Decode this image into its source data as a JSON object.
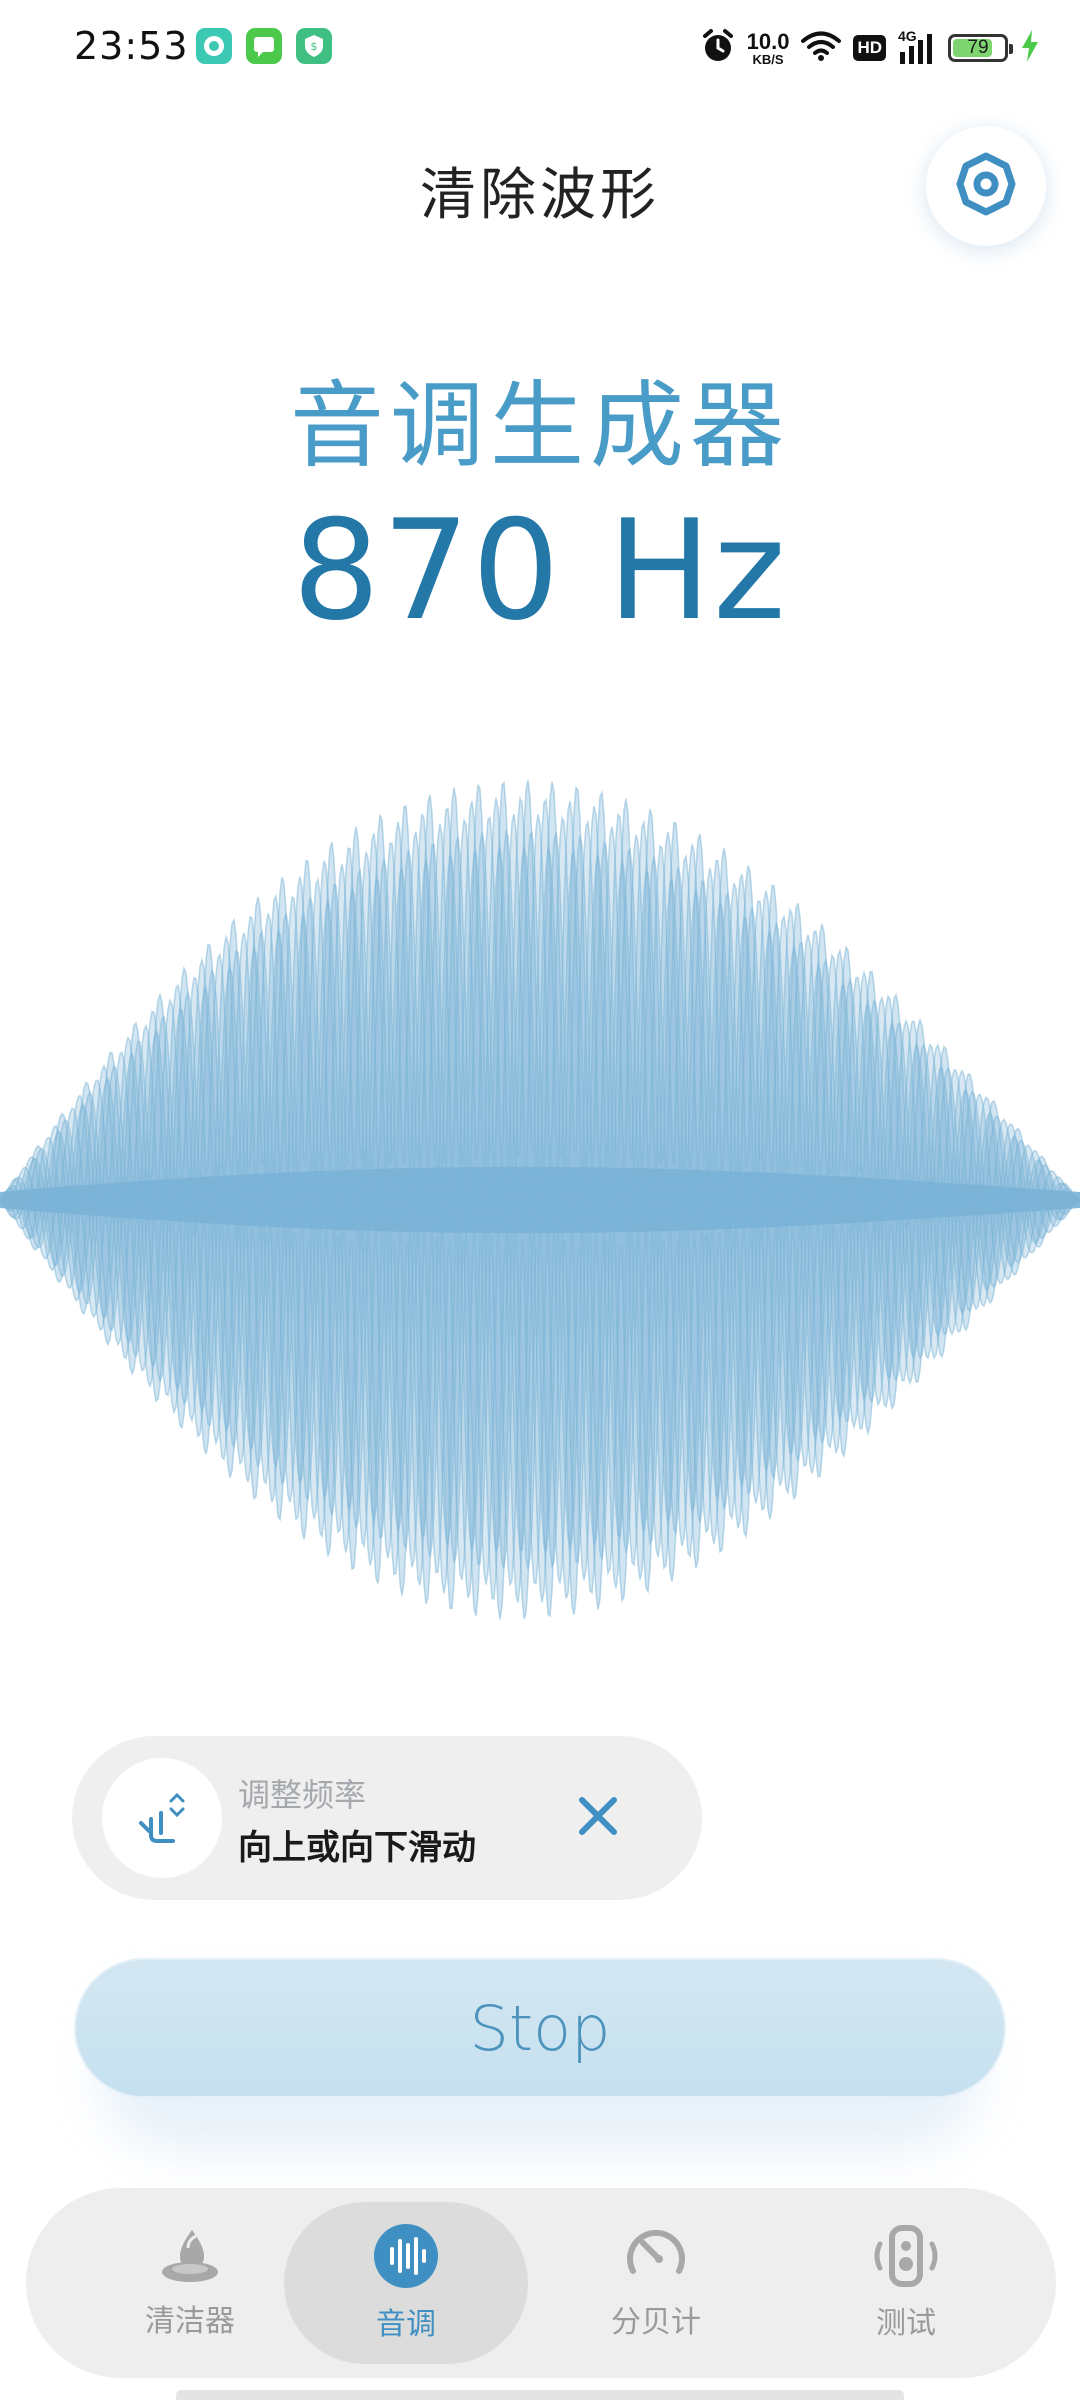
{
  "status_bar": {
    "time": "23:53",
    "net_speed_value": "10.0",
    "net_speed_unit": "KB/S",
    "hd_label": "HD",
    "signal_label": "4G",
    "battery_level": 79,
    "battery_text": "79",
    "app_icons": [
      "message-app-icon",
      "chat-app-icon",
      "shield-app-icon"
    ]
  },
  "header": {
    "title": "清除波形",
    "settings_icon": "gear-icon"
  },
  "generator": {
    "title": "音调生成器",
    "frequency": "870 Hz"
  },
  "hint": {
    "label": "调整频率",
    "text": "向上或向下滑动",
    "icon": "swipe-vertical-icon",
    "close_icon": "close-icon"
  },
  "stop_button": {
    "label": "Stop"
  },
  "nav": {
    "items": [
      {
        "label": "清洁器",
        "icon": "water-drop-icon",
        "active": false
      },
      {
        "label": "音调",
        "icon": "sound-wave-icon",
        "active": true
      },
      {
        "label": "分贝计",
        "icon": "gauge-icon",
        "active": false
      },
      {
        "label": "测试",
        "icon": "speaker-test-icon",
        "active": false
      }
    ]
  },
  "colors": {
    "accent": "#4a9cc8",
    "frequency": "#2478a8",
    "wave": "#7ab3d6",
    "stop_bg": "#cde4f1"
  }
}
